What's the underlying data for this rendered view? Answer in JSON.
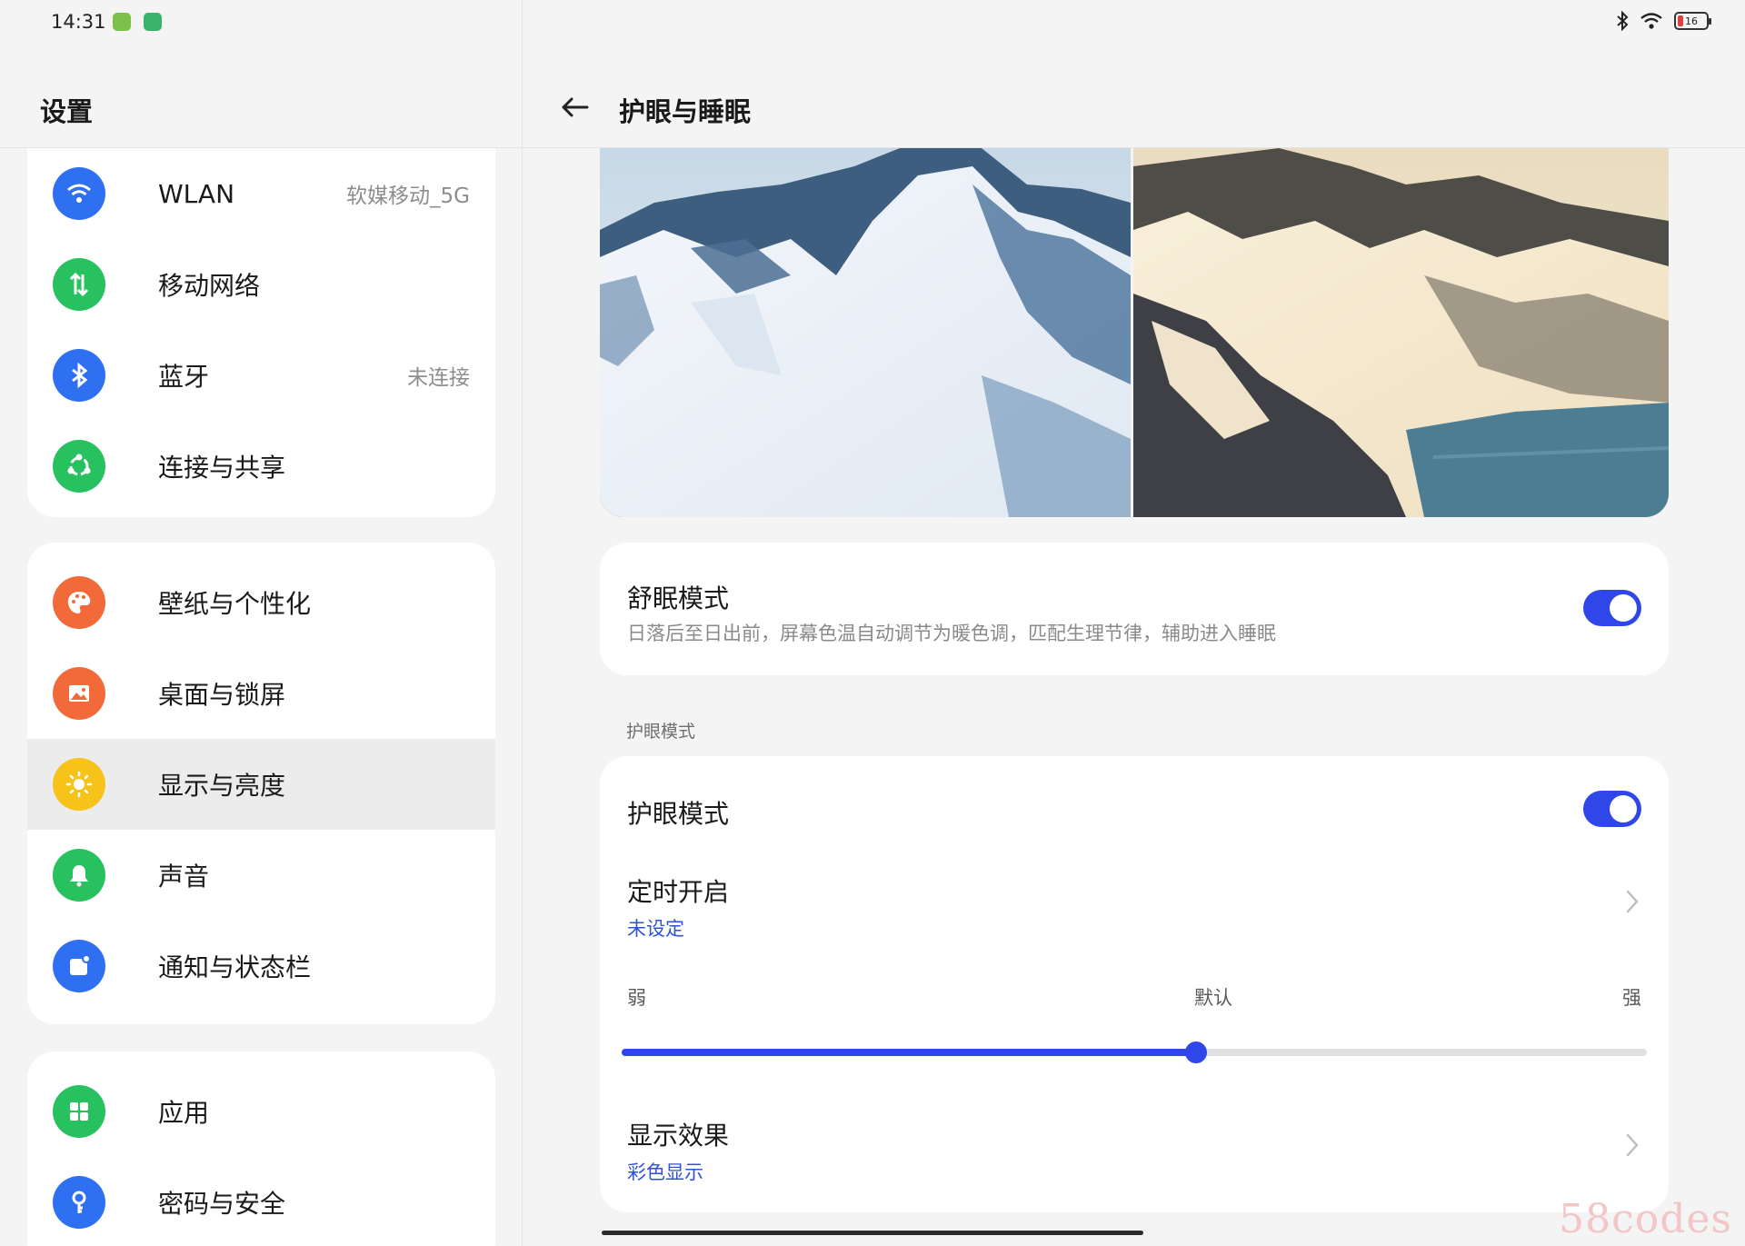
{
  "status_bar": {
    "time": "14:31",
    "battery": "16",
    "icons": [
      "android-icon",
      "app-icon",
      "bluetooth-icon",
      "wifi-icon",
      "battery-icon"
    ]
  },
  "sidebar": {
    "title": "设置",
    "groups": [
      {
        "items": [
          {
            "label": "WLAN",
            "value": "软媒移动_5G",
            "icon": "wifi-icon",
            "color": "#2f6ff2"
          },
          {
            "label": "移动网络",
            "value": "",
            "icon": "mobile-data-icon",
            "color": "#27c25f"
          },
          {
            "label": "蓝牙",
            "value": "未连接",
            "icon": "bluetooth-icon",
            "color": "#2f6ff2"
          },
          {
            "label": "连接与共享",
            "value": "",
            "icon": "share-icon",
            "color": "#27c25f"
          }
        ]
      },
      {
        "items": [
          {
            "label": "壁纸与个性化",
            "icon": "palette-icon",
            "color": "#f26a3a"
          },
          {
            "label": "桌面与锁屏",
            "icon": "image-icon",
            "color": "#f26a3a"
          },
          {
            "label": "显示与亮度",
            "icon": "sun-icon",
            "color": "#f7c21a",
            "selected": true
          },
          {
            "label": "声音",
            "icon": "bell-icon",
            "color": "#27c25f"
          },
          {
            "label": "通知与状态栏",
            "icon": "notification-icon",
            "color": "#2f6ff2"
          }
        ]
      },
      {
        "items": [
          {
            "label": "应用",
            "icon": "apps-icon",
            "color": "#27c25f"
          },
          {
            "label": "密码与安全",
            "icon": "key-icon",
            "color": "#2f6ff2"
          }
        ]
      }
    ]
  },
  "main": {
    "title": "护眼与睡眠",
    "sleep_mode": {
      "title": "舒眠模式",
      "description": "日落后至日出前，屏幕色温自动调节为暖色调，匹配生理节律，辅助进入睡眠",
      "enabled": true
    },
    "eye_section_label": "护眼模式",
    "eye_mode": {
      "title": "护眼模式",
      "enabled": true
    },
    "schedule": {
      "title": "定时开启",
      "value": "未设定"
    },
    "intensity": {
      "min_label": "弱",
      "mid_label": "默认",
      "max_label": "强",
      "value": 0.56
    },
    "display_effect": {
      "title": "显示效果",
      "value": "彩色显示"
    }
  },
  "accent_color": "#2f46e8",
  "watermark": "58codes"
}
